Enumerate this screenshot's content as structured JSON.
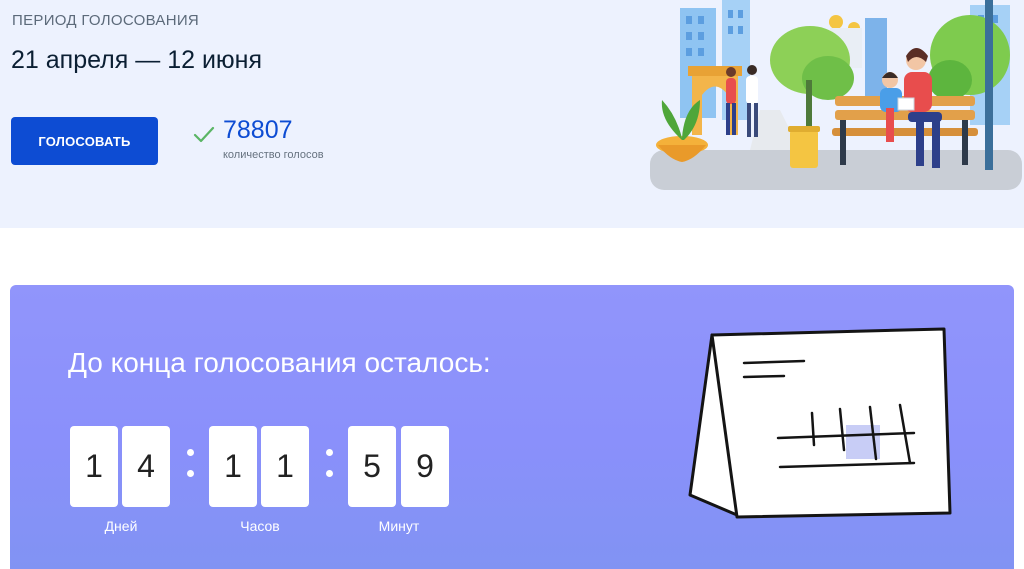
{
  "voting": {
    "period_label": "ПЕРИОД ГОЛОСОВАНИЯ",
    "dates": "21 апреля — 12 июня",
    "vote_button": "ГОЛОСОВАТЬ",
    "votes_count": "78807",
    "votes_label": "количество голосов"
  },
  "countdown": {
    "title": "До конца голосования осталось:",
    "days": [
      "1",
      "4"
    ],
    "hours": [
      "1",
      "1"
    ],
    "minutes": [
      "5",
      "9"
    ],
    "days_label": "Дней",
    "hours_label": "Часов",
    "minutes_label": "Минут"
  },
  "colors": {
    "primary": "#0d4cd3",
    "check": "#5ab565",
    "card_bg": "#8a90fb",
    "top_bg": "#edf2fe"
  }
}
